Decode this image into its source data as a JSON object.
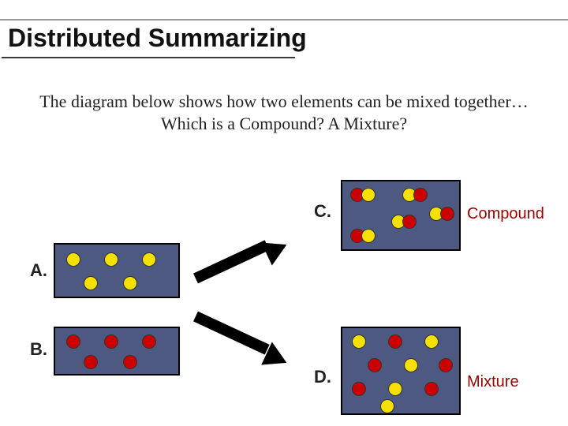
{
  "title": "Distributed Summarizing",
  "subtitle": "The diagram below shows how two elements can be mixed together…Which is a Compound? A Mixture?",
  "labels": {
    "a": "A.",
    "b": "B.",
    "c": "C.",
    "d": "D.",
    "compound": "Compound",
    "mixture": "Mixture"
  },
  "boxes": {
    "A": {
      "description": "single element – yellow atoms",
      "dots": [
        "yellow",
        "yellow",
        "yellow",
        "yellow",
        "yellow"
      ]
    },
    "B": {
      "description": "single element – red atoms",
      "dots": [
        "red",
        "red",
        "red",
        "red",
        "red"
      ]
    },
    "C": {
      "description": "compound – bonded red-yellow pairs",
      "pairs": 5
    },
    "D": {
      "description": "mixture – unbonded red and yellow atoms",
      "yellow": 5,
      "red": 5
    }
  },
  "answers": {
    "compound": "C",
    "mixture": "D"
  }
}
